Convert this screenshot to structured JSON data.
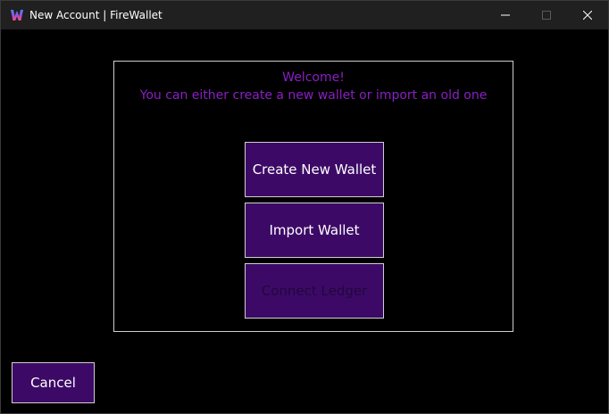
{
  "window": {
    "title": "New Account | FireWallet",
    "controls": [
      "minimize",
      "maximize",
      "close"
    ]
  },
  "icons": {
    "app": "firewallet-logo-icon",
    "minimize": "minimize-icon",
    "maximize": "maximize-icon",
    "close": "close-icon"
  },
  "colors": {
    "background": "#000000",
    "titlebar": "#202020",
    "accent_text": "#8a1fc4",
    "button_fill": "#3c0a66",
    "border": "#cfcfcf"
  },
  "main": {
    "welcome": "Welcome!",
    "subtitle": "You can either create a new wallet or import an old one",
    "buttons": {
      "create": "Create New Wallet",
      "import": "Import Wallet",
      "ledger": "Connect Ledger"
    }
  },
  "footer": {
    "cancel": "Cancel"
  }
}
